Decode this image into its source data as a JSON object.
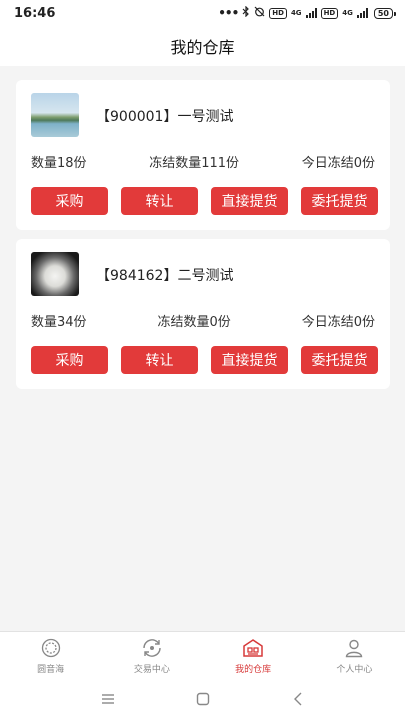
{
  "status_bar": {
    "time": "16:46",
    "dots": "•••",
    "hd1": "HD",
    "net1": "4G",
    "hd2": "HD",
    "net2": "4G",
    "battery": "50"
  },
  "header": {
    "title": "我的仓库"
  },
  "products": [
    {
      "name": "【900001】一号测试",
      "quantity": "数量18份",
      "frozen": "冻结数量111份",
      "today_frozen": "今日冻结0份",
      "buttons": [
        "采购",
        "转让",
        "直接提货",
        "委托提货"
      ]
    },
    {
      "name": "【984162】二号测试",
      "quantity": "数量34份",
      "frozen": "冻结数量0份",
      "today_frozen": "今日冻结0份",
      "buttons": [
        "采购",
        "转让",
        "直接提货",
        "委托提货"
      ]
    }
  ],
  "tabs": [
    {
      "label": "圆音海",
      "icon": "circle-badge-icon"
    },
    {
      "label": "交易中心",
      "icon": "exchange-icon"
    },
    {
      "label": "我的仓库",
      "icon": "warehouse-icon",
      "active": true
    },
    {
      "label": "个人中心",
      "icon": "user-icon"
    }
  ],
  "colors": {
    "accent": "#e23a3a",
    "active_tab": "#d73a3a",
    "background": "#f4f4f4"
  }
}
